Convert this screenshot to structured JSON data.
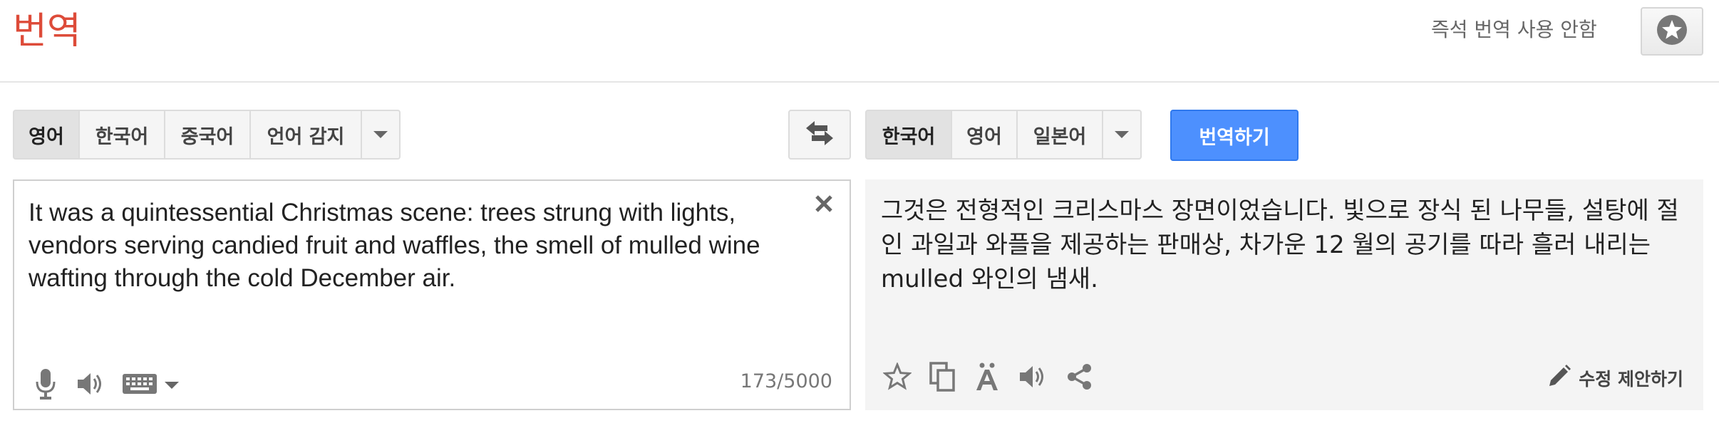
{
  "header": {
    "title": "번역",
    "instant_toggle_label": "즉석 번역 사용 안함",
    "star_icon": "star-icon"
  },
  "source_langs": {
    "items": [
      {
        "label": "영어",
        "selected": true
      },
      {
        "label": "한국어",
        "selected": false
      },
      {
        "label": "중국어",
        "selected": false
      },
      {
        "label": "언어 감지",
        "selected": false
      }
    ]
  },
  "target_langs": {
    "items": [
      {
        "label": "한국어",
        "selected": true
      },
      {
        "label": "영어",
        "selected": false
      },
      {
        "label": "일본어",
        "selected": false
      }
    ]
  },
  "translate_button": "번역하기",
  "source": {
    "text": "It was a quintessential Christmas scene: trees strung with lights, vendors serving candied fruit and waffles, the smell of mulled wine wafting through the cold December air.",
    "char_count": "173/5000"
  },
  "result": {
    "text": "그것은 전형적인 크리스마스 장면이었습니다. 빛으로 장식 된 나무들, 설탕에 절인 과일과 와플을 제공하는 판매상, 차가운 12 월의 공기를 따라 흘러 내리는 mulled 와인의 냄새.",
    "suggest_edit": "수정 제안하기"
  },
  "colors": {
    "title": "#dd4b39",
    "primary_button": "#4d90fe"
  }
}
